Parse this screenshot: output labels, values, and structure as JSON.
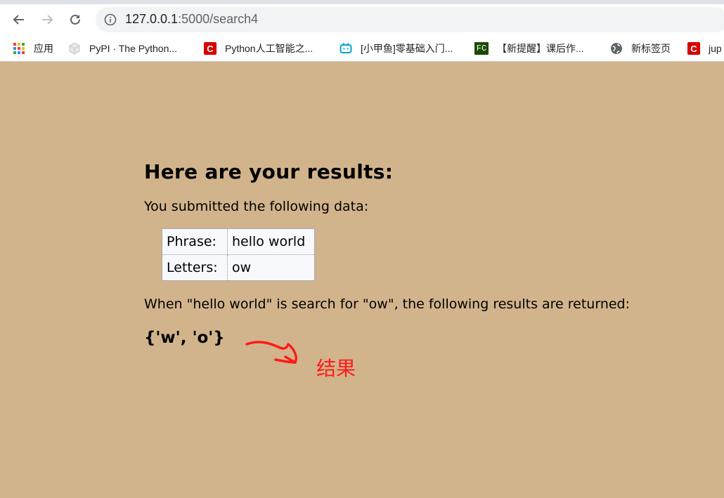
{
  "browser": {
    "url_host": "127.0.0.1",
    "url_rest": ":5000/search4"
  },
  "bookmarks": [
    {
      "label": "应用",
      "icon": "apps-grid-icon"
    },
    {
      "label": "PyPI · The Python...",
      "icon": "pypi-cube-icon"
    },
    {
      "label": "Python人工智能之...",
      "icon": "csdn-icon",
      "icon_text": "C"
    },
    {
      "label": "[小甲鱼]零基础入门...",
      "icon": "bilibili-tv-icon"
    },
    {
      "label": "【新提醒】课后作...",
      "icon": "fishc-icon",
      "icon_text": "FC"
    },
    {
      "label": "新标签页",
      "icon": "globe-icon"
    },
    {
      "label": "jup",
      "icon": "csdn-icon",
      "icon_text": "C"
    }
  ],
  "page": {
    "heading": "Here are your results:",
    "submitted_text": "You submitted the following data:",
    "table": [
      {
        "label": "Phrase:",
        "value": "hello world"
      },
      {
        "label": "Letters:",
        "value": "ow"
      }
    ],
    "when_text": "When \"hello world\" is search for \"ow\", the following results are returned:",
    "result": "{'w', 'o'}"
  },
  "annotation": {
    "text": "结果",
    "color": "#ff1a1a"
  },
  "colors": {
    "page_background": "#d2b48c"
  }
}
